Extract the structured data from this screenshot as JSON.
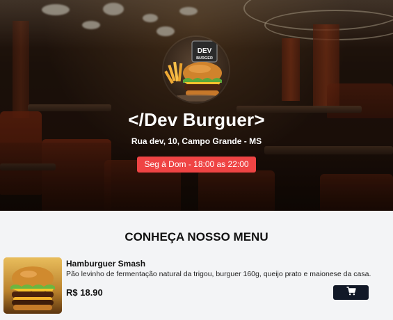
{
  "header": {
    "logo_text_top": "DEV",
    "logo_text_bottom": "BURGER",
    "title": "</Dev Burguer>",
    "address": "Rua dev, 10, Campo Grande - MS",
    "hours": "Seg á Dom - 18:00 as 22:00"
  },
  "menu": {
    "heading": "CONHEÇA NOSSO MENU",
    "items": [
      {
        "name": "Hamburguer Smash",
        "description": "Pão levinho de fermentação natural da trigou, burguer 160g, queijo prato e maionese da casa.",
        "price": "R$ 18.90",
        "button_icon": "cart-icon"
      }
    ]
  },
  "colors": {
    "accent": "#ef4444",
    "button": "#111827",
    "background": "#f3f4f6"
  }
}
